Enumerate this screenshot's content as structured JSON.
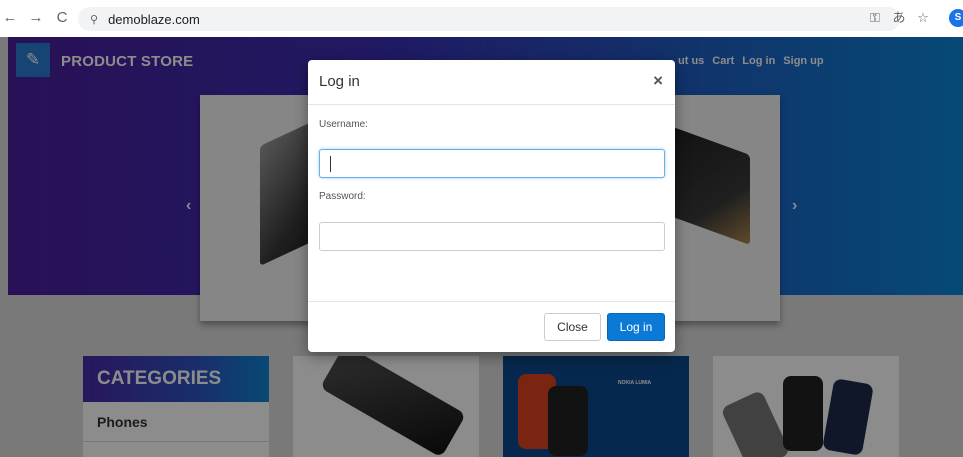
{
  "browser": {
    "back_icon": "←",
    "forward_icon": "→",
    "reload_icon": "C",
    "site_info_icon": "⚲",
    "url": "demoblaze.com",
    "key_icon": "⚿",
    "translate_icon": "あ",
    "star_icon": "☆",
    "profile_initial": "S"
  },
  "header": {
    "brand": "PRODUCT STORE",
    "nav": [
      "ut us",
      "Cart",
      "Log in",
      "Sign up"
    ]
  },
  "carousel": {
    "prev": "‹",
    "next": "›"
  },
  "categories": {
    "title": "CATEGORIES",
    "items": [
      "Phones"
    ]
  },
  "modal": {
    "title": "Log in",
    "close_symbol": "×",
    "username_label": "Username:",
    "username_value": "",
    "password_label": "Password:",
    "password_value": "",
    "close_button": "Close",
    "login_button": "Log in"
  },
  "cards": {
    "nokia_label": "NOKIA LUMIA"
  }
}
